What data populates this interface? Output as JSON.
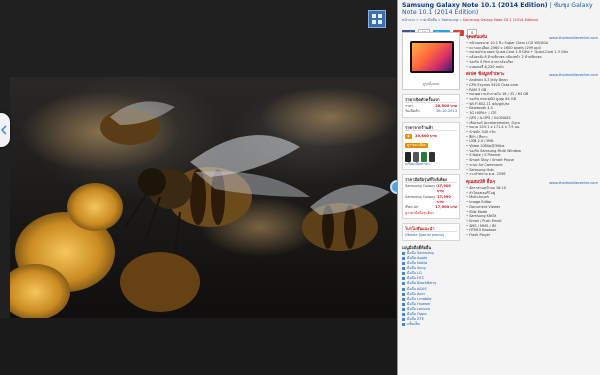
{
  "viewer": {
    "grid_icon": "grid-view-icon",
    "prev_icon": "chevron-left-icon",
    "divider_icon": "split-handle-icon",
    "photo_subject": "honeybee-on-honeycomb"
  },
  "page": {
    "title": "Samsung Galaxy Note 10.1 (2014 Edition)",
    "title_suffix": "ซัมซุง Galaxy Note 10.1 (2014 Edition)",
    "breadcrumb": [
      {
        "label": "หน้าแรก",
        "active": false
      },
      {
        "label": "ราคามือถือ",
        "active": false
      },
      {
        "label": "Samsung",
        "active": false
      },
      {
        "label": "Samsung Galaxy Note 10.1 (2014 Edition)",
        "active": true
      }
    ],
    "social": {
      "facebook": "แชร์",
      "facebook_count": "13",
      "twitter": "Tweet",
      "gplus": "+1",
      "count": "0"
    }
  },
  "left": {
    "thumb_caption": "ดูรูปทั้งหมด",
    "price_box": {
      "heading": "ราคาเปิดตัวครั้งแรก",
      "price_label": "ราคา",
      "price": "20,500 บาท",
      "date_label": "วันเปิดตัว",
      "date": "06-10-2013"
    },
    "store_box": {
      "heading": "ราคาจากร้านค้า",
      "store_price": "20,800 บาท",
      "store_button": "ดูรายละเอียด",
      "more_label": "เปรียบเทียบราคา"
    },
    "compare_box": {
      "heading": "ราคามือถือรุ่นที่ใกล้เคียง",
      "items": [
        {
          "name": "Samsung Galaxy Note 10.1",
          "price": "17,900 บาท"
        },
        {
          "name": "Samsung Galaxy Tab 3",
          "price": "17,990 บาท"
        },
        {
          "name": "iPad Air",
          "price": "17,900 บาท"
        }
      ],
      "link": "ดูราคามือถือรุ่นอื่นๆ"
    },
    "promo": {
      "heading": "โปรโมชั่นแนะนำ",
      "subtitle": "(Mobile Special promo)"
    },
    "nav": {
      "heading": "เมนูมือถือยี่ห้ออื่น",
      "items": [
        "มือถือ Samsung",
        "มือถือ Apple",
        "มือถือ Nokia",
        "มือถือ Sony",
        "มือถือ LG",
        "มือถือ HTC",
        "มือถือ BlackBerry",
        "มือถือ ASUS",
        "มือถือ Acer",
        "มือถือ i-mobile",
        "มือถือ Huawei",
        "มือถือ Lenovo",
        "มือถือ Oppo",
        "มือถือ ZTE",
        "แท็บเล็ต"
      ]
    }
  },
  "right": {
    "sections": [
      {
        "heading": "จุดเด่นเด่น",
        "url": "www.thaimobilecenter.com",
        "items": [
          "หน้าจอขนาด 10.1 นิ้ว Super Clear LCD WQXGA",
          "ความละเอียด 2560 x 1600 pixels (299 ppi)",
          "หน่วยประมวลผล Quad-Core 1.9 GHz + Quad-Core 1.3 GHz",
          "กล้องหลัง 8 ล้านพิกเซล กล้องหน้า 2 ล้านพิกเซล",
          "รองรับ S Pen ปากกาอัจฉริยะ",
          "แบตเตอรี่ 8,220 mAh"
        ]
      },
      {
        "heading": "สเปค ข้อมูลจำเพาะ",
        "url": "www.thaimobilecenter.com",
        "items": [
          "Android 4.3 Jelly Bean",
          "CPU Exynos 5420 Octa-core",
          "RAM 3 GB",
          "หน่วยความจำภายใน 16 / 32 / 64 GB",
          "รองรับ microSD สูงสุด 64 GB",
          "Wi-Fi 802.11 a/b/g/n/ac",
          "Bluetooth 4.0",
          "3G HSPA+ / LTE",
          "GPS / A-GPS / GLONASS",
          "เซ็นเซอร์ Accelerometer, Gyro",
          "ขนาด 243.1 x 171.4 x 7.9 มม.",
          "น้ำหนัก 540 กรัม",
          "สีดำ / สีขาว",
          "USB 2.0 / MHL",
          "Video 1080p@30fps",
          "รองรับ Samsung Multi Window",
          "S Note / S Planner",
          "Smart Stay / Smart Pause",
          "ระบบ Air Command",
          "Samsung Hub",
          "วางจำหน่าย ต.ค. 2556"
        ]
      },
      {
        "heading": "คุณสมบัติ อื่นๆ",
        "url": "www.thaimobilecenter.com",
        "items": [
          "อัตราส่วนหน้าจอ 16:10",
          "ลำโพงสเตอริโอคู่",
          "Multi-touch",
          "Image Editor",
          "Document Viewer",
          "Kids Mode",
          "Samsung KNOX",
          "Email / Push Email",
          "SMS / MMS / IM",
          "HTML5 Browser",
          "Flash Player"
        ]
      }
    ]
  },
  "colors": {
    "title": "#0b3d8c",
    "price": "#d4141e",
    "link": "#1e5bb0",
    "accent": "#c21e1e"
  }
}
